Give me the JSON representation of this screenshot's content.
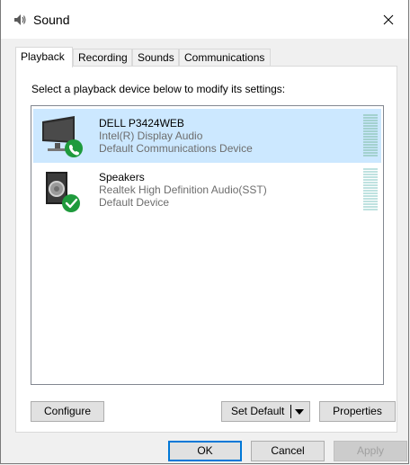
{
  "window": {
    "title": "Sound",
    "close_glyph": "✕"
  },
  "tabs": [
    {
      "label": "Playback",
      "active": true
    },
    {
      "label": "Recording",
      "active": false
    },
    {
      "label": "Sounds",
      "active": false
    },
    {
      "label": "Communications",
      "active": false
    }
  ],
  "panel": {
    "instruction": "Select a playback device below to modify its settings:"
  },
  "devices": [
    {
      "name": "DELL P3424WEB",
      "driver": "Intel(R) Display Audio",
      "status": "Default Communications Device",
      "icon": "monitor-icon",
      "badge": "phone-badge-icon",
      "selected": true
    },
    {
      "name": "Speakers",
      "driver": "Realtek High Definition Audio(SST)",
      "status": "Default Device",
      "icon": "speaker-icon",
      "badge": "check-badge-icon",
      "selected": false
    }
  ],
  "panel_buttons": {
    "configure": "Configure",
    "set_default": "Set Default",
    "properties": "Properties"
  },
  "dialog_buttons": {
    "ok": "OK",
    "cancel": "Cancel",
    "apply": "Apply"
  },
  "colors": {
    "selection": "#cce8ff",
    "badge_green": "#1e9a3c",
    "default_button_border": "#0078d7"
  }
}
